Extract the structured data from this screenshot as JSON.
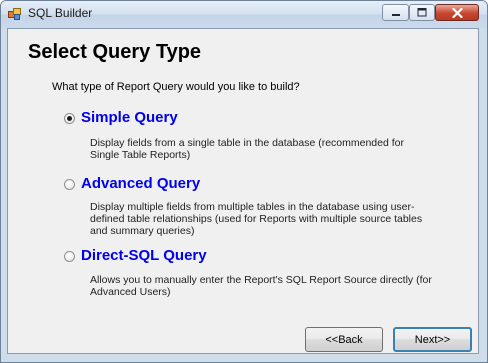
{
  "window": {
    "title": "SQL Builder",
    "icons": {
      "app": "sql-builder-app-icon",
      "minimize": "minimize-icon",
      "maximize": "maximize-icon",
      "close": "close-icon"
    }
  },
  "page": {
    "heading": "Select Query Type",
    "question": "What type of Report Query would you like to build?"
  },
  "options": [
    {
      "label": "Simple Query",
      "selected": true,
      "description_lines": [
        "Display fields from a single table in the database (recommended for",
        "Single Table Reports)"
      ]
    },
    {
      "label": "Advanced Query",
      "selected": false,
      "description_lines": [
        "Display multiple fields from multiple tables in the database using user-",
        "defined table relationships (used for Reports with multiple source tables",
        "and summary queries)"
      ]
    },
    {
      "label": "Direct-SQL Query",
      "selected": false,
      "description_lines": [
        "Allows you to manually enter the Report's SQL Report Source directly (for",
        "Advanced Users)"
      ]
    }
  ],
  "buttons": {
    "back": "<<Back",
    "next": "Next>>"
  },
  "colors": {
    "option_label": "#0000ee",
    "client_bg": "#f0f0f0",
    "frame": "#cfdcea"
  }
}
